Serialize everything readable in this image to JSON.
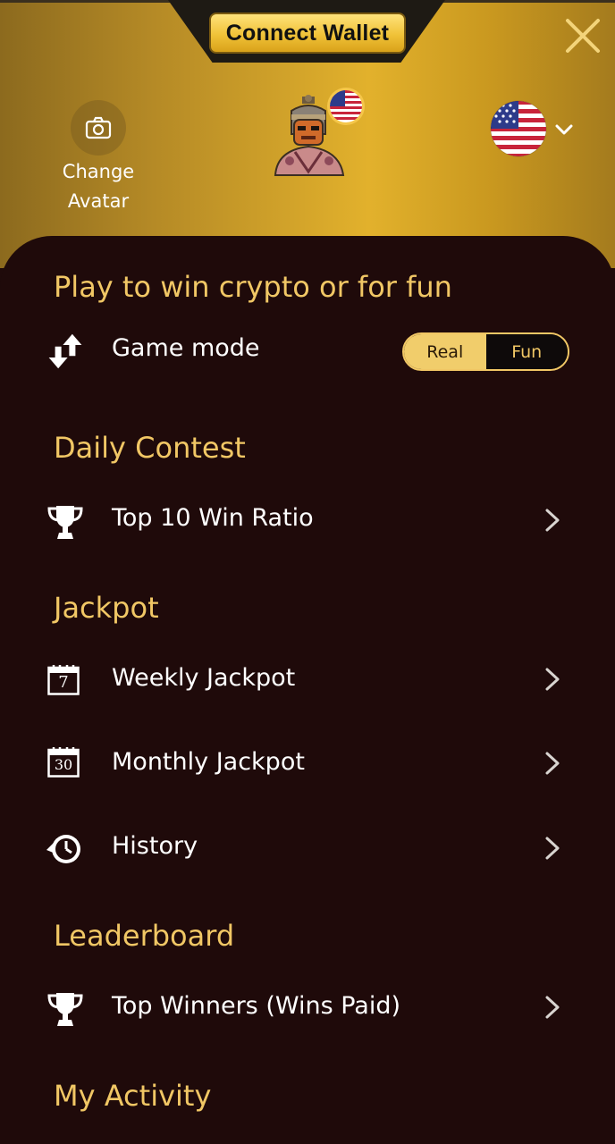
{
  "header": {
    "connect_wallet_label": "Connect Wallet",
    "change_avatar_line1": "Change",
    "change_avatar_line2": "Avatar"
  },
  "sections": {
    "game_mode_title": "Play to win crypto or for fun",
    "daily_contest_title": "Daily Contest",
    "jackpot_title": "Jackpot",
    "leaderboard_title": "Leaderboard",
    "my_activity_title": "My Activity"
  },
  "game_mode": {
    "label": "Game mode",
    "options": [
      "Real",
      "Fun"
    ],
    "selected": "Real"
  },
  "items": {
    "top10_win_ratio": "Top 10 Win Ratio",
    "weekly_jackpot": "Weekly Jackpot",
    "weekly_calendar_number": "7",
    "monthly_jackpot": "Monthly Jackpot",
    "monthly_calendar_number": "30",
    "history": "History",
    "top_winners": "Top Winners (Wins Paid)"
  },
  "colors": {
    "accent_gold": "#f1c765",
    "panel_background": "#1f0a0a",
    "text_white": "#ffffff"
  },
  "icons": {
    "close": "close-icon",
    "camera": "camera-icon",
    "flag": "us-flag-icon",
    "chevron_down": "chevron-down-icon",
    "game_mode": "arrows-updown-icon",
    "trophy": "trophy-icon",
    "calendar": "calendar-icon",
    "history": "history-clock-icon",
    "chevron_right": "chevron-right-icon"
  }
}
